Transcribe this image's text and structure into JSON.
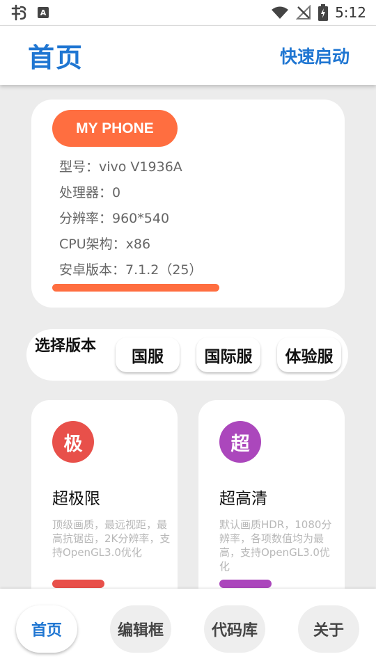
{
  "status_bar": {
    "time": "5:12",
    "left_icons": [
      "bug-icon",
      "keyboard-a-icon"
    ],
    "right_icons": [
      "wifi-icon",
      "no-signal-icon",
      "battery-icon"
    ]
  },
  "header": {
    "title": "首页",
    "action_label": "快速启动",
    "accent_color": "#1f76d2"
  },
  "device_card": {
    "badge": "MY PHONE",
    "badge_color": "#ff6e40",
    "specs": [
      "型号：vivo V1936A",
      "处理器：0",
      "分辨率：960*540",
      "CPU架构：x86",
      "安卓版本：7.1.2（25）"
    ]
  },
  "version_selector": {
    "label": "选择版本",
    "options": [
      "国服",
      "国际服",
      "体验服"
    ]
  },
  "quality_cards": [
    {
      "badge": "极",
      "badge_color": "#e8504a",
      "title": "超极限",
      "desc": "顶级画质，最远视距，最高抗锯齿，2K分辨率，支持OpenGL3.0优化",
      "bar_color": "#e8504a"
    },
    {
      "badge": "超",
      "badge_color": "#ab47bc",
      "title": "超高清",
      "desc": "默认画质HDR，1080分辨率，各项数值均为最高，支持OpenGL3.0优化",
      "bar_color": "#ab47bc"
    }
  ],
  "bottom_nav": {
    "items": [
      "首页",
      "编辑框",
      "代码库",
      "关于"
    ],
    "active": "首页"
  }
}
